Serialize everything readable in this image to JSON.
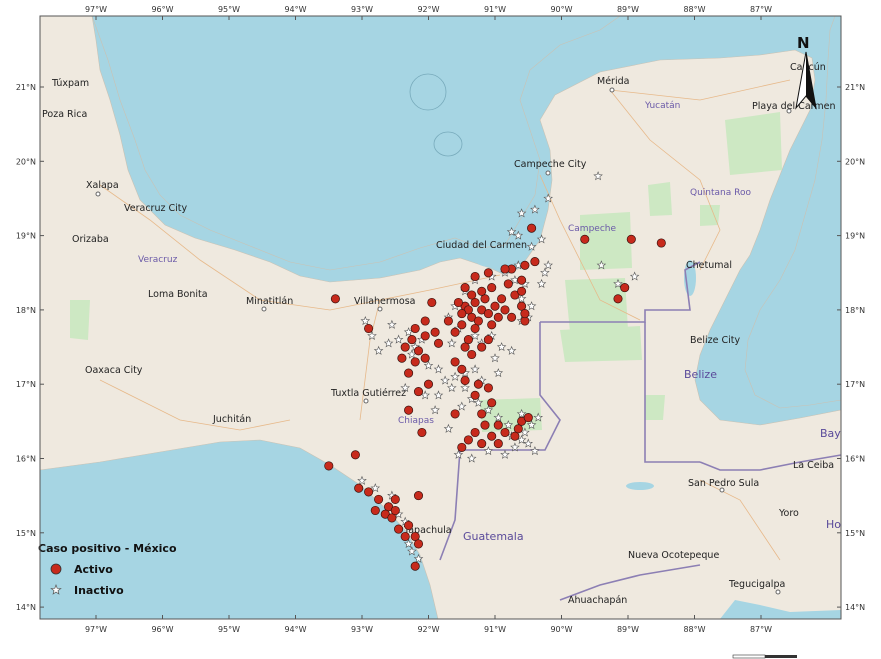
{
  "map": {
    "colors": {
      "water": "#a6d5e3",
      "land": "#efe9df",
      "park": "#cde8c3",
      "border": "#8c7fb4",
      "active": "#c72a1c",
      "inactive": "#ffffff",
      "frame": "#555555"
    },
    "top_ticks": [
      "97°W",
      "96°W",
      "95°W",
      "94°W",
      "93°W",
      "92°W",
      "91°W",
      "90°W",
      "89°W",
      "88°W",
      "87°W"
    ],
    "bottom_ticks": [
      "97°W",
      "96°W",
      "95°W",
      "94°W",
      "93°W",
      "92°W",
      "91°W",
      "90°W",
      "89°W",
      "88°W",
      "87°W"
    ],
    "left_ticks": [
      "21°N",
      "20°N",
      "19°N",
      "18°N",
      "17°N",
      "16°N",
      "15°N",
      "14°N"
    ],
    "right_ticks": [
      "21°N",
      "20°N",
      "19°N",
      "18°N",
      "17°N",
      "16°N",
      "15°N",
      "14°N"
    ],
    "places": [
      {
        "name": "Mérida"
      },
      {
        "name": "Yucatán"
      },
      {
        "name": "Cancún"
      },
      {
        "name": "Playa del Carmen"
      },
      {
        "name": "Túxpam"
      },
      {
        "name": "Poza Rica"
      },
      {
        "name": "Xalapa"
      },
      {
        "name": "Veracruz City"
      },
      {
        "name": "Orizaba"
      },
      {
        "name": "Veracruz"
      },
      {
        "name": "Loma Bonita"
      },
      {
        "name": "Minatitlán"
      },
      {
        "name": "Villahermosa"
      },
      {
        "name": "Oaxaca City"
      },
      {
        "name": "Tuxtla Gutiérrez"
      },
      {
        "name": "Juchitán"
      },
      {
        "name": "Chiapas"
      },
      {
        "name": "Campeche City"
      },
      {
        "name": "Campeche"
      },
      {
        "name": "Ciudad del Carmen"
      },
      {
        "name": "Quintana Roo"
      },
      {
        "name": "Chetumal"
      },
      {
        "name": "Belize City"
      },
      {
        "name": "Belize"
      },
      {
        "name": "Bay"
      },
      {
        "name": "La Ceiba"
      },
      {
        "name": "San Pedro Sula"
      },
      {
        "name": "Yoro"
      },
      {
        "name": "Ho"
      },
      {
        "name": "Tapachula"
      },
      {
        "name": "Guatemala"
      },
      {
        "name": "Nueva Ocotepeque"
      },
      {
        "name": "Ahuachapán"
      },
      {
        "name": "Tegucigalpa"
      }
    ],
    "north_arrow": "N",
    "legend": {
      "title": "Caso positivo - México",
      "active_label": "Activo",
      "inactive_label": "Inactivo"
    },
    "active_points": [
      [
        -91.45,
        18.05
      ],
      [
        -91.4,
        18.0
      ],
      [
        -91.3,
        18.1
      ],
      [
        -91.2,
        18.0
      ],
      [
        -91.1,
        17.95
      ],
      [
        -91.35,
        17.9
      ],
      [
        -91.25,
        17.85
      ],
      [
        -91.5,
        17.95
      ],
      [
        -91.55,
        18.1
      ],
      [
        -91.15,
        18.15
      ],
      [
        -91.0,
        18.05
      ],
      [
        -90.95,
        17.9
      ],
      [
        -91.05,
        17.8
      ],
      [
        -91.3,
        17.75
      ],
      [
        -91.4,
        17.6
      ],
      [
        -91.6,
        17.7
      ],
      [
        -91.7,
        17.85
      ],
      [
        -91.2,
        18.25
      ],
      [
        -91.05,
        18.3
      ],
      [
        -90.9,
        18.15
      ],
      [
        -90.85,
        18.0
      ],
      [
        -90.7,
        18.2
      ],
      [
        -90.6,
        18.05
      ],
      [
        -90.55,
        17.85
      ],
      [
        -90.75,
        17.9
      ],
      [
        -91.45,
        18.3
      ],
      [
        -91.3,
        18.45
      ],
      [
        -91.1,
        18.5
      ],
      [
        -90.75,
        18.55
      ],
      [
        -90.55,
        18.6
      ],
      [
        -90.4,
        18.65
      ],
      [
        -90.6,
        18.4
      ],
      [
        -90.8,
        18.35
      ],
      [
        -91.2,
        17.5
      ],
      [
        -91.35,
        17.4
      ],
      [
        -91.6,
        17.3
      ],
      [
        -91.5,
        17.2
      ],
      [
        -91.45,
        17.05
      ],
      [
        -91.25,
        17.0
      ],
      [
        -91.1,
        16.95
      ],
      [
        -91.3,
        16.85
      ],
      [
        -91.2,
        16.6
      ],
      [
        -91.15,
        16.45
      ],
      [
        -91.3,
        16.35
      ],
      [
        -91.4,
        16.25
      ],
      [
        -91.2,
        16.2
      ],
      [
        -91.05,
        16.3
      ],
      [
        -90.95,
        16.2
      ],
      [
        -90.85,
        16.35
      ],
      [
        -90.7,
        16.3
      ],
      [
        -90.6,
        16.5
      ],
      [
        -90.65,
        16.4
      ],
      [
        -91.5,
        16.15
      ],
      [
        -91.05,
        16.75
      ],
      [
        -91.85,
        17.55
      ],
      [
        -91.9,
        17.7
      ],
      [
        -92.05,
        17.65
      ],
      [
        -92.2,
        17.75
      ],
      [
        -92.25,
        17.6
      ],
      [
        -92.15,
        17.45
      ],
      [
        -92.2,
        17.3
      ],
      [
        -92.05,
        17.35
      ],
      [
        -92.3,
        17.15
      ],
      [
        -92.0,
        17.0
      ],
      [
        -92.15,
        16.9
      ],
      [
        -92.35,
        17.5
      ],
      [
        -92.4,
        17.35
      ],
      [
        -92.05,
        17.85
      ],
      [
        -91.95,
        18.1
      ],
      [
        -92.1,
        16.35
      ],
      [
        -93.4,
        18.15
      ],
      [
        -92.9,
        17.75
      ],
      [
        -92.3,
        16.65
      ],
      [
        -93.1,
        16.05
      ],
      [
        -93.5,
        15.9
      ],
      [
        -93.05,
        15.6
      ],
      [
        -92.9,
        15.55
      ],
      [
        -92.75,
        15.45
      ],
      [
        -92.6,
        15.35
      ],
      [
        -92.5,
        15.45
      ],
      [
        -92.65,
        15.25
      ],
      [
        -92.8,
        15.3
      ],
      [
        -92.55,
        15.2
      ],
      [
        -92.45,
        15.05
      ],
      [
        -92.3,
        15.1
      ],
      [
        -92.15,
        15.5
      ],
      [
        -92.2,
        14.95
      ],
      [
        -92.15,
        14.85
      ],
      [
        -92.2,
        14.55
      ],
      [
        -92.35,
        14.95
      ],
      [
        -92.5,
        15.3
      ],
      [
        -90.45,
        19.1
      ],
      [
        -89.65,
        18.95
      ],
      [
        -88.95,
        18.95
      ],
      [
        -88.5,
        18.9
      ],
      [
        -89.05,
        18.3
      ],
      [
        -89.15,
        18.15
      ],
      [
        -90.85,
        18.55
      ],
      [
        -90.6,
        18.25
      ],
      [
        -91.1,
        17.6
      ],
      [
        -91.45,
        17.5
      ],
      [
        -90.95,
        16.45
      ],
      [
        -90.5,
        16.55
      ],
      [
        -91.6,
        16.6
      ],
      [
        -90.55,
        17.95
      ],
      [
        -91.5,
        17.8
      ],
      [
        -91.35,
        18.2
      ]
    ],
    "inactive_points": [
      [
        -89.45,
        19.8
      ],
      [
        -90.2,
        19.5
      ],
      [
        -90.4,
        19.35
      ],
      [
        -90.6,
        19.3
      ],
      [
        -90.75,
        19.05
      ],
      [
        -90.65,
        19.0
      ],
      [
        -90.3,
        18.95
      ],
      [
        -90.45,
        18.85
      ],
      [
        -90.2,
        18.6
      ],
      [
        -90.25,
        18.5
      ],
      [
        -90.3,
        18.35
      ],
      [
        -90.55,
        18.35
      ],
      [
        -90.85,
        18.5
      ],
      [
        -90.65,
        18.6
      ],
      [
        -91.05,
        18.45
      ],
      [
        -91.3,
        18.4
      ],
      [
        -91.45,
        18.25
      ],
      [
        -91.6,
        18.05
      ],
      [
        -91.7,
        17.9
      ],
      [
        -91.55,
        17.75
      ],
      [
        -91.3,
        17.65
      ],
      [
        -91.2,
        17.55
      ],
      [
        -91.05,
        17.65
      ],
      [
        -90.9,
        17.5
      ],
      [
        -90.75,
        17.45
      ],
      [
        -90.6,
        17.85
      ],
      [
        -90.5,
        17.9
      ],
      [
        -90.45,
        18.05
      ],
      [
        -90.6,
        18.15
      ],
      [
        -90.7,
        18.4
      ],
      [
        -92.1,
        17.6
      ],
      [
        -92.2,
        17.5
      ],
      [
        -92.25,
        17.4
      ],
      [
        -92.3,
        17.7
      ],
      [
        -92.45,
        17.6
      ],
      [
        -92.6,
        17.55
      ],
      [
        -92.75,
        17.45
      ],
      [
        -92.85,
        17.65
      ],
      [
        -92.95,
        17.85
      ],
      [
        -92.55,
        17.8
      ],
      [
        -92.0,
        17.25
      ],
      [
        -91.85,
        17.2
      ],
      [
        -91.75,
        17.05
      ],
      [
        -91.65,
        16.95
      ],
      [
        -91.45,
        16.95
      ],
      [
        -91.35,
        16.8
      ],
      [
        -91.25,
        16.75
      ],
      [
        -91.1,
        16.65
      ],
      [
        -90.95,
        16.55
      ],
      [
        -90.8,
        16.45
      ],
      [
        -90.75,
        16.3
      ],
      [
        -90.6,
        16.25
      ],
      [
        -90.55,
        16.35
      ],
      [
        -90.5,
        16.2
      ],
      [
        -90.45,
        16.45
      ],
      [
        -90.6,
        16.6
      ],
      [
        -90.7,
        16.15
      ],
      [
        -90.85,
        16.05
      ],
      [
        -91.1,
        16.1
      ],
      [
        -91.35,
        16.0
      ],
      [
        -91.55,
        16.05
      ],
      [
        -91.7,
        16.4
      ],
      [
        -91.85,
        16.85
      ],
      [
        -92.05,
        16.85
      ],
      [
        -91.6,
        17.1
      ],
      [
        -91.45,
        17.15
      ],
      [
        -91.2,
        17.05
      ],
      [
        -91.3,
        17.2
      ],
      [
        -92.6,
        15.35
      ],
      [
        -92.45,
        15.25
      ],
      [
        -92.35,
        15.15
      ],
      [
        -92.3,
        14.85
      ],
      [
        -92.25,
        14.75
      ],
      [
        -92.15,
        14.65
      ],
      [
        -92.55,
        15.5
      ],
      [
        -92.8,
        15.6
      ],
      [
        -93.0,
        15.7
      ],
      [
        -89.4,
        18.6
      ],
      [
        -89.15,
        18.35
      ],
      [
        -88.9,
        18.45
      ],
      [
        -91.65,
        17.55
      ],
      [
        -91.0,
        17.35
      ],
      [
        -90.95,
        17.15
      ],
      [
        -91.5,
        16.7
      ],
      [
        -90.35,
        16.55
      ],
      [
        -90.4,
        16.1
      ],
      [
        -91.9,
        16.65
      ],
      [
        -92.35,
        16.95
      ]
    ]
  }
}
